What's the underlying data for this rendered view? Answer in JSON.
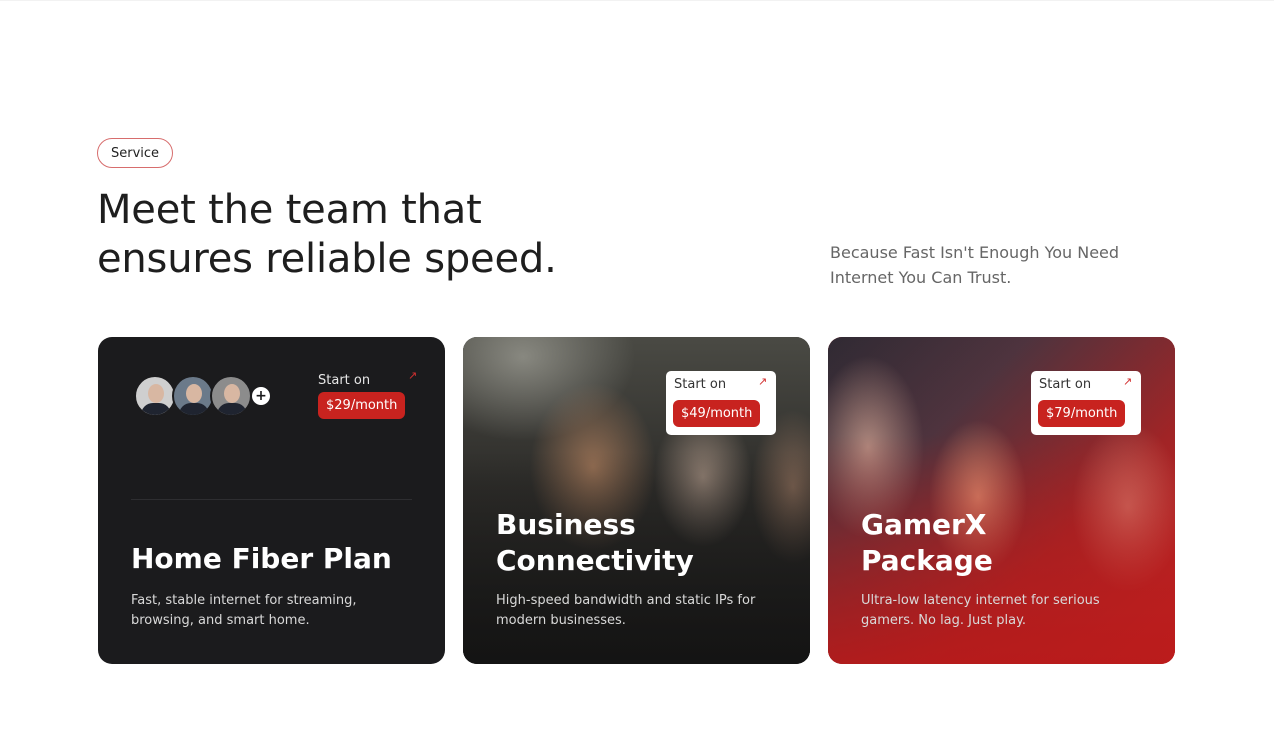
{
  "section": {
    "tag": "Service",
    "headline": "Meet the team that ensures reliable speed.",
    "subtext": "Because Fast Isn't Enough You Need Internet You Can Trust."
  },
  "cards": [
    {
      "title": "Home Fiber Plan",
      "description": "Fast, stable internet for streaming, browsing, and smart home.",
      "price_label": "Start on",
      "price": "$29/month",
      "avatar_more": "+"
    },
    {
      "title": "Business Connectivity",
      "description": "High-speed bandwidth and static IPs for modern businesses.",
      "price_label": "Start on",
      "price": "$49/month"
    },
    {
      "title": "GamerX Package",
      "description": "Ultra-low latency internet for serious gamers. No lag. Just play.",
      "price_label": "Start on",
      "price": "$79/month"
    }
  ],
  "colors": {
    "accent": "#c8231f",
    "card_dark": "#1b1b1d",
    "pill_border": "#d76d6d"
  },
  "icons": {
    "arrow": "arrow-up-right-icon"
  }
}
